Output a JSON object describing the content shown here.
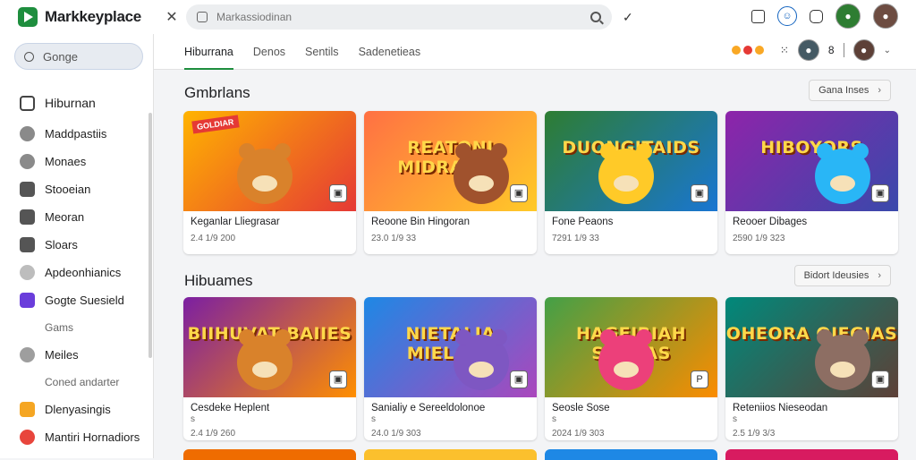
{
  "app": {
    "name": "Markkeyplace"
  },
  "search": {
    "placeholder": "Markassiodinan"
  },
  "topbar": {
    "icons": [
      "external-icon",
      "profile-icon",
      "chat-icon"
    ]
  },
  "sidebar": {
    "search_label": "Gonge",
    "items": [
      {
        "label": "Hiburnan",
        "icon": "home-icon",
        "color": "#444444"
      },
      {
        "label": "Maddpastiis",
        "icon": "circle-icon",
        "color": "#8a8a8a"
      },
      {
        "label": "Monaes",
        "icon": "circle-icon",
        "color": "#8a8a8a"
      },
      {
        "label": "Stooeian",
        "icon": "grid-icon",
        "color": "#555555"
      },
      {
        "label": "Meoran",
        "icon": "box-icon",
        "color": "#555555"
      },
      {
        "label": "Sloars",
        "icon": "list-icon",
        "color": "#555555"
      },
      {
        "label": "Apdeonhianics",
        "icon": "circle-icon",
        "color": "#bdbdbd"
      },
      {
        "label": "Gogte Suesield",
        "icon": "app-icon",
        "color": "#6a3ddb"
      },
      {
        "label": "Gams",
        "sub": true
      },
      {
        "label": "Meiles",
        "icon": "circle-icon",
        "color": "#9e9e9e"
      },
      {
        "label": "Coned andarter",
        "sub": true
      },
      {
        "label": "Dlenyasingis",
        "icon": "tag-icon",
        "color": "#f5a623"
      },
      {
        "label": "Mantiri Hornadiors",
        "icon": "globe-icon",
        "color": "#e8453c"
      }
    ]
  },
  "tabs": [
    {
      "label": "Hiburrana",
      "active": true
    },
    {
      "label": "Denos",
      "active": false
    },
    {
      "label": "Sentils",
      "active": false
    },
    {
      "label": "Sadenetieas",
      "active": false
    }
  ],
  "tabs_right": {
    "count": "8"
  },
  "sections": [
    {
      "title": "Gmbrlans",
      "more_label": "Gana Inses",
      "cards": [
        {
          "title": "Keganlar Lliegrasar",
          "meta": "2.4 1/9 200",
          "banner": "",
          "ribbon": "GOLDIAR",
          "badge": "▣",
          "colors": [
            "#ffb300",
            "#e53935"
          ],
          "mascot": "#d9822b"
        },
        {
          "title": "Reoone Bin Hingoran",
          "meta": "23.0 1/9 33",
          "banner": "REATONI MIDRAEIHI",
          "ribbon": "",
          "badge": "▣",
          "colors": [
            "#ff7043",
            "#ffca28"
          ],
          "mascot": "#a0522d"
        },
        {
          "title": "Fone Peaons",
          "meta": "7291 1/9 33",
          "banner": "DUONGITAIDS",
          "ribbon": "",
          "badge": "▣",
          "colors": [
            "#2e7d32",
            "#1976d2"
          ],
          "mascot": "#ffca28"
        },
        {
          "title": "Reooer Dibages",
          "meta": "2590 1/9 323",
          "banner": "HIBOYORS",
          "ribbon": "",
          "badge": "▣",
          "colors": [
            "#8e24aa",
            "#3949ab"
          ],
          "mascot": "#29b6f6"
        }
      ]
    },
    {
      "title": "Hibuames",
      "more_label": "Bidort Ideusies",
      "cards": [
        {
          "title": "Cesdeke Heplent",
          "sub": "s",
          "meta": "2.4 1/9 260",
          "banner": "BIIHUVAT BAIIES",
          "ribbon": "",
          "badge": "▣",
          "colors": [
            "#7b1fa2",
            "#ff8f00"
          ],
          "mascot": "#d9822b"
        },
        {
          "title": "Sanialiy e Sereeldolonoe",
          "sub": "s",
          "meta": "24.0 1/9 303",
          "banner": "NIETALIA MIELARS",
          "ribbon": "",
          "badge": "▣",
          "colors": [
            "#1e88e5",
            "#ab47bc"
          ],
          "mascot": "#7e57c2"
        },
        {
          "title": "Seosle Sose",
          "sub": "s",
          "meta": "2024 1/9 303",
          "banner": "HAGEIRIAH SERNAS",
          "ribbon": "",
          "badge": "P",
          "colors": [
            "#43a047",
            "#fb8c00"
          ],
          "mascot": "#ec407a"
        },
        {
          "title": "Reteniios Nieseodan",
          "sub": "s",
          "meta": "2.5 1/9 3/3",
          "banner": "OHEORA OIEGIAS",
          "ribbon": "",
          "badge": "▣",
          "colors": [
            "#00897b",
            "#5d4037"
          ],
          "mascot": "#8d6e63"
        }
      ]
    }
  ],
  "peek_colors": [
    "#ef6c00",
    "#fbc02d",
    "#1e88e5",
    "#d81b60"
  ]
}
